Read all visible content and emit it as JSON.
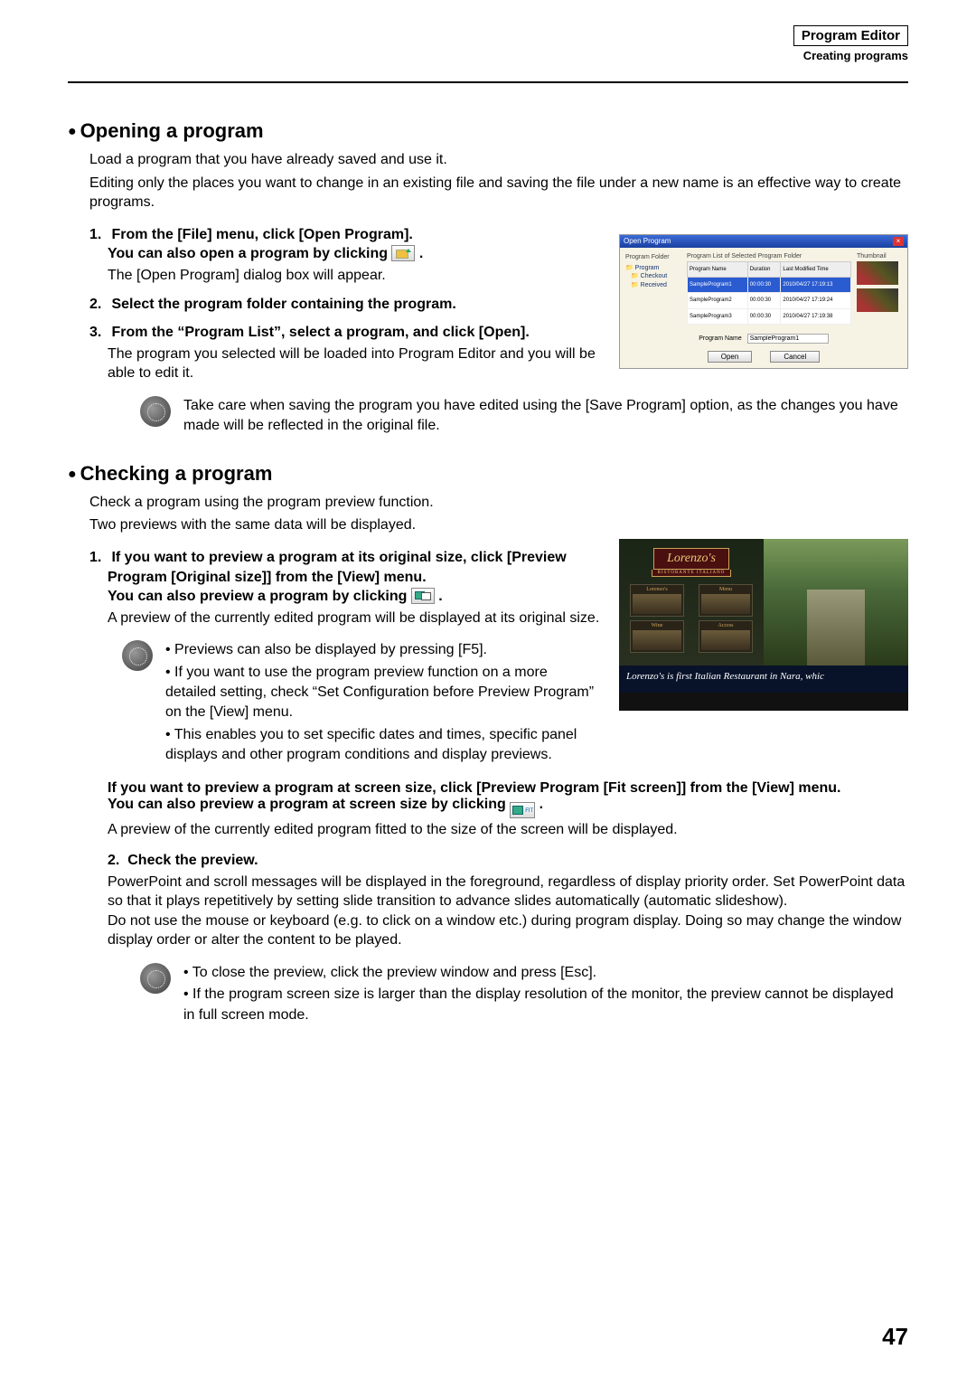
{
  "header": {
    "box": "Program Editor",
    "sub": "Creating programs"
  },
  "page_number": "47",
  "opening": {
    "title": "Opening a program",
    "intro1": "Load a program that you have already saved and use it.",
    "intro2": "Editing only the places you want to change in an existing file and saving the file under a new name is an effective way to create programs.",
    "step1a": "From the [File] menu, click [Open Program].",
    "step1b": "You can also open a program by clicking ",
    "step1b_tail": " .",
    "step1_body": "The [Open Program] dialog box will appear.",
    "step2": "Select the program folder containing the program.",
    "step3a": "From the “Program List”, select a program, and click [Open].",
    "step3_body": "The program you selected will be loaded into Program Editor and you will be able to edit it.",
    "note": "Take care when saving the program you have edited using the [Save Program] option, as the changes you have made will be reflected in the original file."
  },
  "dialog": {
    "title": "Open Program",
    "tree_label": "Program Folder",
    "tree_items": [
      "Program",
      "Checkout",
      "Received"
    ],
    "list_label": "Program List of Selected Program Folder",
    "thumb_label": "Thumbnail",
    "cols": [
      "Program Name",
      "Duration",
      "Last Modified Time"
    ],
    "rows": [
      {
        "name": "SampleProgram1",
        "dur": "00:00:30",
        "mod": "2010/04/27 17:19:13"
      },
      {
        "name": "SampleProgram2",
        "dur": "00:00:30",
        "mod": "2010/04/27 17:19:24"
      },
      {
        "name": "SampleProgram3",
        "dur": "00:00:30",
        "mod": "2010/04/27 17:19:38"
      }
    ],
    "name_label": "Program Name",
    "name_value": "SampleProgram1",
    "open": "Open",
    "cancel": "Cancel"
  },
  "checking": {
    "title": "Checking a program",
    "intro1": "Check a program using the program preview function.",
    "intro2": "Two previews with the same data will be displayed.",
    "step1a": "If you want to preview a program at its original size, click [Preview Program [Original size]] from the [View] menu.",
    "step1b": "You can also preview a program by clicking ",
    "step1b_tail": " .",
    "step1_body": "A preview of the currently edited program will be displayed at its original size.",
    "note1_li1": "Previews can also be displayed by pressing [F5].",
    "note1_li2": "If you want to use the program preview function on a more detailed setting, check “Set Configuration before Preview Program” on the [View] menu.",
    "note1_li3": "This enables you to set specific dates and times, specific panel displays and other program conditions and display previews.",
    "fit_a": "If you want to preview a program at screen size, click [Preview Program [Fit screen]] from the [View] menu.",
    "fit_b": "You can also preview a program at screen size by clicking ",
    "fit_b_tail": " .",
    "fit_body": "A preview of the currently edited program fitted to the size of the screen will be displayed.",
    "step2": "Check the preview.",
    "step2_body": "PowerPoint and scroll messages will be displayed in the foreground, regardless of display priority order. Set PowerPoint data so that it plays repetitively by setting slide transition to advance slides automatically (automatic slideshow).\nDo not use the mouse or keyboard (e.g. to click on a window etc.) during program display. Doing so may change the window display order or alter the content to be played.",
    "note2_li1": "To close the preview, click the preview window and press [Esc].",
    "note2_li2": "If the program screen size is larger than the display resolution of the monitor, the preview cannot be displayed in full screen mode."
  },
  "preview": {
    "name": "Lorenzo's",
    "subtitle": "RISTORANTE  ITALIANO",
    "thumbs": [
      "Lorenzo's",
      "Menu",
      "Wine",
      "Access"
    ],
    "caption": "Lorenzo's is first Italian Restaurant in Nara, whic"
  }
}
